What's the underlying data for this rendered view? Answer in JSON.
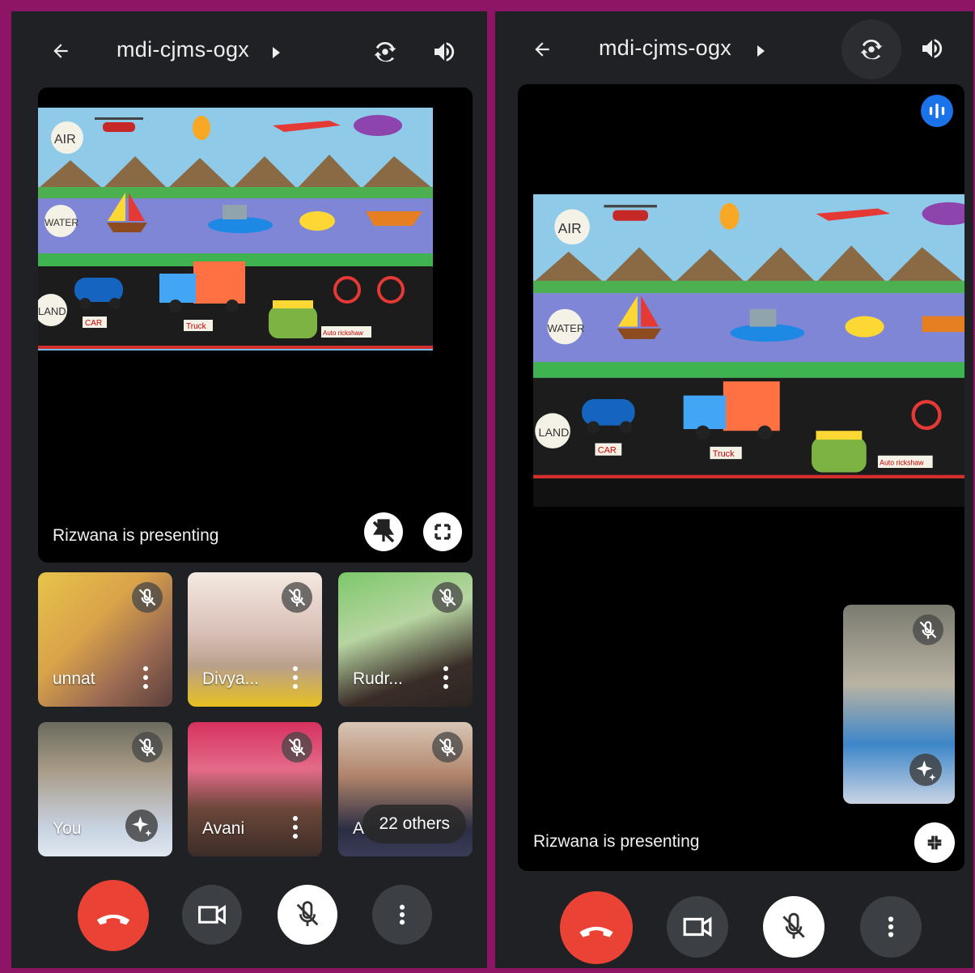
{
  "left": {
    "meeting_code": "mdi-cjms-ogx",
    "stage": {
      "presenting_text": "Rizwana is presenting"
    },
    "tiles": [
      {
        "name": "unnat"
      },
      {
        "name": "Divya..."
      },
      {
        "name": "Rudr..."
      },
      {
        "name": "You"
      },
      {
        "name": "Avani"
      },
      {
        "name": "A",
        "others_label": "22 others"
      }
    ]
  },
  "right": {
    "meeting_code": "mdi-cjms-ogx",
    "stage": {
      "presenting_text": "Rizwana is presenting"
    }
  },
  "drawing_labels": {
    "air": "AIR",
    "water": "WATER",
    "land": "LAND",
    "helicopter": "Helicopter",
    "balloon": "Hot air balloon",
    "aeroplane": "Aeroplane",
    "blimp": "Blimp",
    "sailboat": "Sail boat",
    "ship": "Ship",
    "submarine": "Submarine",
    "boat": "Boat",
    "car": "CAR",
    "truck": "Truck",
    "autorickshaw": "Auto rickshaw",
    "bicycle": "Bicycle"
  },
  "colors": {
    "frame": "#8e1466",
    "end_call": "#ea4335",
    "audio_indicator": "#1a73e8",
    "panel": "#1f2124"
  },
  "icons": [
    "back-arrow-icon",
    "play-caret-icon",
    "switch-camera-icon",
    "speaker-icon",
    "unpin-icon",
    "fullscreen-icon",
    "mic-off-icon",
    "more-vert-icon",
    "visual-effects-icon",
    "end-call-icon",
    "video-camera-icon",
    "exit-fullscreen-icon",
    "audio-level-icon"
  ]
}
